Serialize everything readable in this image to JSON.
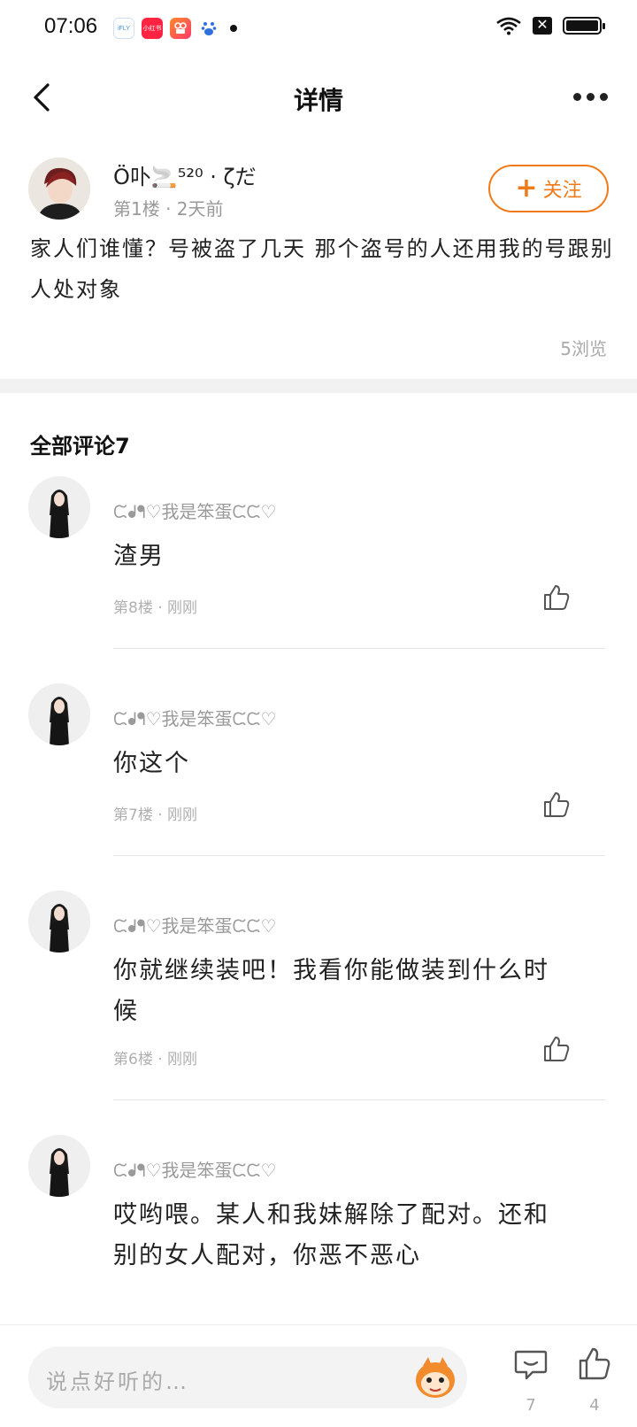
{
  "status_bar": {
    "time": "07:06",
    "apps": [
      {
        "name": "ifly-app-icon",
        "label": "iFLY",
        "color": "#ffffff"
      },
      {
        "name": "xiaohongshu-app-icon",
        "label": "小红书",
        "color": "#ff2442"
      },
      {
        "name": "kuaishou-app-icon",
        "label": "",
        "color": "#ff6a2a"
      },
      {
        "name": "baidu-app-icon",
        "label": "",
        "color": "#ffffff"
      }
    ]
  },
  "nav": {
    "title": "详情"
  },
  "post": {
    "author": "Ö卟🚬⁵²⁰ · ζだ",
    "meta": "第1楼 · 2天前",
    "follow_label": "关注",
    "body": "家人们谁懂？号被盗了几天 那个盗号的人还用我的号跟别人处对象",
    "views": "5浏览"
  },
  "comments_header": "全部评论7",
  "comments": [
    {
      "name": "ᙅᖱᖳ♡我是笨蛋ᙅᙅ♡",
      "text": "渣男",
      "meta": "第8楼 · 刚刚"
    },
    {
      "name": "ᙅᖱᖳ♡我是笨蛋ᙅᙅ♡",
      "text": "你这个",
      "meta": "第7楼 · 刚刚"
    },
    {
      "name": "ᙅᖱᖳ♡我是笨蛋ᙅᙅ♡",
      "text": "你就继续装吧！我看你能做装到什么时候",
      "meta": "第6楼 · 刚刚"
    },
    {
      "name": "ᙅᖱᖳ♡我是笨蛋ᙅᙅ♡",
      "text": "哎哟喂。某人和我妹解除了配对。还和别的女人配对，你恶不恶心",
      "meta": ""
    }
  ],
  "bottom": {
    "placeholder": "说点好听的…",
    "comment_count": "7",
    "like_count": "4"
  },
  "colors": {
    "accent": "#f07a1a",
    "band": "#f2f2f2"
  }
}
